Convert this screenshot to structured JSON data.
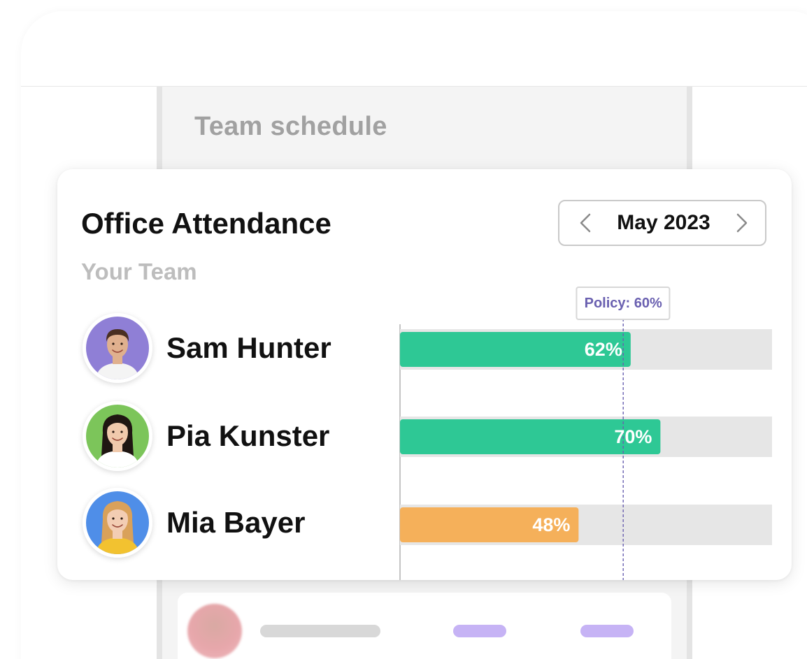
{
  "schedule": {
    "title": "Team schedule"
  },
  "card": {
    "title": "Office Attendance",
    "subtitle": "Your Team",
    "month": "May 2023"
  },
  "policy": {
    "label": "Policy: 60%",
    "value": 60
  },
  "colors": {
    "above_policy": "#2ec895",
    "below_policy": "#f5b05a",
    "track": "#e6e6e6",
    "policy_line": "#6a60b0"
  },
  "chart_data": {
    "type": "bar",
    "orientation": "horizontal",
    "categories": [
      "Sam Hunter",
      "Pia Kunster",
      "Mia Bayer"
    ],
    "values": [
      62,
      70,
      48
    ],
    "value_labels": [
      "62%",
      "70%",
      "48%"
    ],
    "xlim": [
      0,
      100
    ],
    "reference_line": 60
  },
  "people": [
    {
      "name": "Sam Hunter",
      "avatar_icon": "avatar-sam-icon",
      "bg": "#8f7fd6",
      "skin": "#e0b08e",
      "hair": "#4a2f22",
      "shirt": "#f4f4f4"
    },
    {
      "name": "Pia Kunster",
      "avatar_icon": "avatar-pia-icon",
      "bg": "#7cc55a",
      "skin": "#f0c9ac",
      "hair": "#1f1612",
      "shirt": "#ffffff"
    },
    {
      "name": "Mia Bayer",
      "avatar_icon": "avatar-mia-icon",
      "bg": "#4f8ee8",
      "skin": "#f3cdb3",
      "hair": "#d9a15a",
      "shirt": "#f2c230"
    }
  ]
}
